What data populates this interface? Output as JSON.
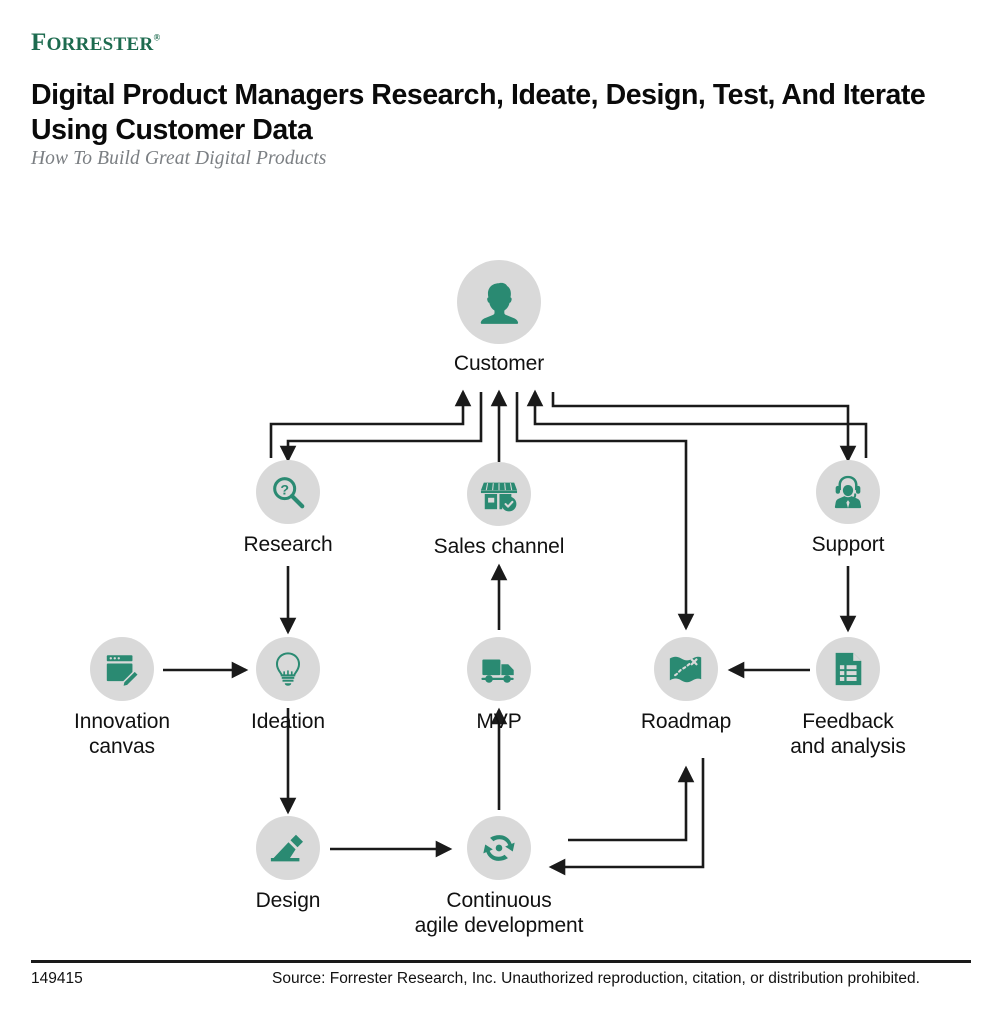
{
  "brand": {
    "logo_main": "ORRESTER",
    "logo_initial": "F",
    "logo_registered": "®",
    "accent_color": "#1d6b4f",
    "icon_color": "#2a8a72",
    "disc_color": "#d9d9d9"
  },
  "header": {
    "title": "Digital Product Managers Research, Ideate, Design, Test, And Iterate Using Customer Data",
    "subtitle": "How To Build Great Digital Products"
  },
  "chart_data": {
    "type": "diagram",
    "title": "Digital Product Managers Research, Ideate, Design, Test, And Iterate Using Customer Data",
    "nodes": [
      {
        "id": "customer",
        "label": "Customer",
        "icon": "person-icon",
        "row": 1,
        "col": "center"
      },
      {
        "id": "research",
        "label": "Research",
        "icon": "magnifier-question-icon",
        "row": 2,
        "col": "left"
      },
      {
        "id": "sales",
        "label": "Sales channel",
        "icon": "storefront-check-icon",
        "row": 2,
        "col": "center"
      },
      {
        "id": "support",
        "label": "Support",
        "icon": "headset-agent-icon",
        "row": 2,
        "col": "right"
      },
      {
        "id": "canvas",
        "label": "Innovation\ncanvas",
        "icon": "window-pencil-icon",
        "row": 3,
        "col": "far-left"
      },
      {
        "id": "ideation",
        "label": "Ideation",
        "icon": "lightbulb-icon",
        "row": 3,
        "col": "left"
      },
      {
        "id": "mvp",
        "label": "MVP",
        "icon": "truck-icon",
        "row": 3,
        "col": "center"
      },
      {
        "id": "roadmap",
        "label": "Roadmap",
        "icon": "map-route-icon",
        "row": 3,
        "col": "right-mid"
      },
      {
        "id": "feedback",
        "label": "Feedback\nand analysis",
        "icon": "document-chart-icon",
        "row": 3,
        "col": "right"
      },
      {
        "id": "design",
        "label": "Design",
        "icon": "pencil-slope-icon",
        "row": 4,
        "col": "left"
      },
      {
        "id": "agile",
        "label": "Continuous\nagile development",
        "icon": "sync-arrows-icon",
        "row": 4,
        "col": "center"
      }
    ],
    "edges": [
      {
        "from": "customer",
        "to": "research",
        "label": ""
      },
      {
        "from": "research",
        "to": "customer",
        "label": ""
      },
      {
        "from": "sales",
        "to": "customer",
        "label": ""
      },
      {
        "from": "customer",
        "to": "support",
        "label": ""
      },
      {
        "from": "support",
        "to": "customer",
        "label": ""
      },
      {
        "from": "customer",
        "to": "roadmap",
        "label": ""
      },
      {
        "from": "research",
        "to": "ideation",
        "label": ""
      },
      {
        "from": "canvas",
        "to": "ideation",
        "label": ""
      },
      {
        "from": "ideation",
        "to": "design",
        "label": ""
      },
      {
        "from": "design",
        "to": "agile",
        "label": ""
      },
      {
        "from": "agile",
        "to": "mvp",
        "label": ""
      },
      {
        "from": "mvp",
        "to": "sales",
        "label": ""
      },
      {
        "from": "agile",
        "to": "roadmap",
        "label": ""
      },
      {
        "from": "roadmap",
        "to": "agile",
        "label": ""
      },
      {
        "from": "feedback",
        "to": "roadmap",
        "label": ""
      },
      {
        "from": "support",
        "to": "feedback",
        "label": ""
      }
    ],
    "legend": [],
    "grid": false
  },
  "footer": {
    "id": "149415",
    "source": "Source: Forrester Research, Inc. Unauthorized reproduction, citation, or distribution prohibited."
  }
}
